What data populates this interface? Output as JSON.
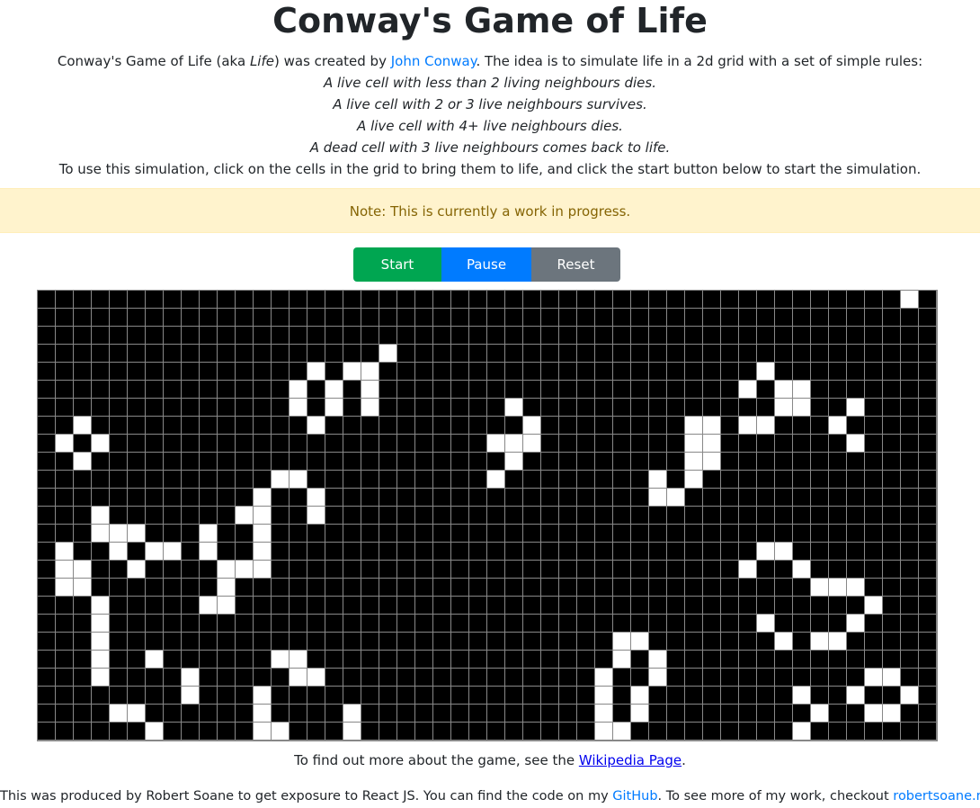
{
  "title": "Conway's Game of Life",
  "intro": {
    "p1_a": "Conway's Game of Life (aka ",
    "p1_em": "Life",
    "p1_b": ") was created by ",
    "p1_link": "John Conway",
    "p1_c": ". The idea is to simulate life in a 2d grid with a set of simple rules:",
    "rules": [
      "A live cell with less than 2 living neighbours dies.",
      "A live cell with 2 or 3 live neighbours survives.",
      "A live cell with 4+ live neighbours dies.",
      "A dead cell with 3 live neighbours comes back to life."
    ],
    "instructions": "To use this simulation, click on the cells in the grid to bring them to life, and click the start button below to start the simulation."
  },
  "alert": "Note: This is currently a work in progress.",
  "controls": {
    "start": "Start",
    "pause": "Pause",
    "reset": "Reset"
  },
  "grid": {
    "cols": 50,
    "rows": 25,
    "alive": [
      [
        0,
        48
      ],
      [
        3,
        19
      ],
      [
        4,
        15
      ],
      [
        4,
        17
      ],
      [
        4,
        18
      ],
      [
        5,
        14
      ],
      [
        5,
        16
      ],
      [
        5,
        18
      ],
      [
        6,
        14
      ],
      [
        6,
        16
      ],
      [
        6,
        18
      ],
      [
        7,
        2
      ],
      [
        7,
        15
      ],
      [
        8,
        1
      ],
      [
        8,
        3
      ],
      [
        9,
        2
      ],
      [
        10,
        13
      ],
      [
        10,
        14
      ],
      [
        11,
        12
      ],
      [
        11,
        15
      ],
      [
        12,
        3
      ],
      [
        12,
        11
      ],
      [
        12,
        12
      ],
      [
        12,
        15
      ],
      [
        13,
        3
      ],
      [
        13,
        4
      ],
      [
        13,
        5
      ],
      [
        13,
        9
      ],
      [
        13,
        12
      ],
      [
        14,
        1
      ],
      [
        14,
        4
      ],
      [
        14,
        6
      ],
      [
        14,
        7
      ],
      [
        14,
        9
      ],
      [
        14,
        12
      ],
      [
        15,
        1
      ],
      [
        15,
        2
      ],
      [
        15,
        5
      ],
      [
        15,
        10
      ],
      [
        15,
        11
      ],
      [
        15,
        12
      ],
      [
        16,
        1
      ],
      [
        16,
        2
      ],
      [
        16,
        10
      ],
      [
        17,
        3
      ],
      [
        17,
        9
      ],
      [
        17,
        10
      ],
      [
        18,
        3
      ],
      [
        19,
        3
      ],
      [
        20,
        3
      ],
      [
        20,
        6
      ],
      [
        20,
        13
      ],
      [
        20,
        14
      ],
      [
        21,
        3
      ],
      [
        21,
        8
      ],
      [
        21,
        14
      ],
      [
        21,
        15
      ],
      [
        22,
        8
      ],
      [
        22,
        12
      ],
      [
        23,
        4
      ],
      [
        23,
        5
      ],
      [
        23,
        12
      ],
      [
        23,
        17
      ],
      [
        24,
        6
      ],
      [
        24,
        12
      ],
      [
        24,
        13
      ],
      [
        24,
        17
      ],
      [
        25,
        16
      ],
      [
        6,
        26
      ],
      [
        7,
        27
      ],
      [
        8,
        25
      ],
      [
        8,
        26
      ],
      [
        8,
        27
      ],
      [
        9,
        26
      ],
      [
        10,
        25
      ],
      [
        19,
        32
      ],
      [
        19,
        33
      ],
      [
        20,
        32
      ],
      [
        20,
        34
      ],
      [
        21,
        31
      ],
      [
        21,
        34
      ],
      [
        22,
        31
      ],
      [
        22,
        33
      ],
      [
        23,
        31
      ],
      [
        23,
        33
      ],
      [
        24,
        31
      ],
      [
        24,
        32
      ],
      [
        25,
        33
      ],
      [
        4,
        40
      ],
      [
        5,
        39
      ],
      [
        5,
        41
      ],
      [
        5,
        42
      ],
      [
        6,
        41
      ],
      [
        6,
        42
      ],
      [
        6,
        45
      ],
      [
        7,
        36
      ],
      [
        7,
        37
      ],
      [
        7,
        39
      ],
      [
        7,
        40
      ],
      [
        7,
        44
      ],
      [
        8,
        36
      ],
      [
        8,
        37
      ],
      [
        8,
        45
      ],
      [
        9,
        36
      ],
      [
        9,
        37
      ],
      [
        10,
        34
      ],
      [
        10,
        36
      ],
      [
        11,
        34
      ],
      [
        11,
        35
      ],
      [
        14,
        40
      ],
      [
        14,
        41
      ],
      [
        15,
        39
      ],
      [
        15,
        42
      ],
      [
        16,
        43
      ],
      [
        16,
        44
      ],
      [
        16,
        45
      ],
      [
        17,
        46
      ],
      [
        18,
        40
      ],
      [
        18,
        45
      ],
      [
        19,
        41
      ],
      [
        19,
        43
      ],
      [
        19,
        44
      ],
      [
        21,
        46
      ],
      [
        21,
        47
      ],
      [
        22,
        42
      ],
      [
        22,
        45
      ],
      [
        22,
        48
      ],
      [
        23,
        43
      ],
      [
        23,
        46
      ],
      [
        23,
        47
      ],
      [
        24,
        42
      ]
    ]
  },
  "more": {
    "text_a": "To find out more about the game, see the ",
    "link": "Wikipedia Page",
    "text_b": "."
  },
  "footer": {
    "text_a": "This was produced by Robert Soane to get exposure to React JS. You can find the code on my ",
    "link1": "GitHub",
    "text_b": ". To see more of my work, checkout ",
    "link2": "robertsoane.me"
  }
}
